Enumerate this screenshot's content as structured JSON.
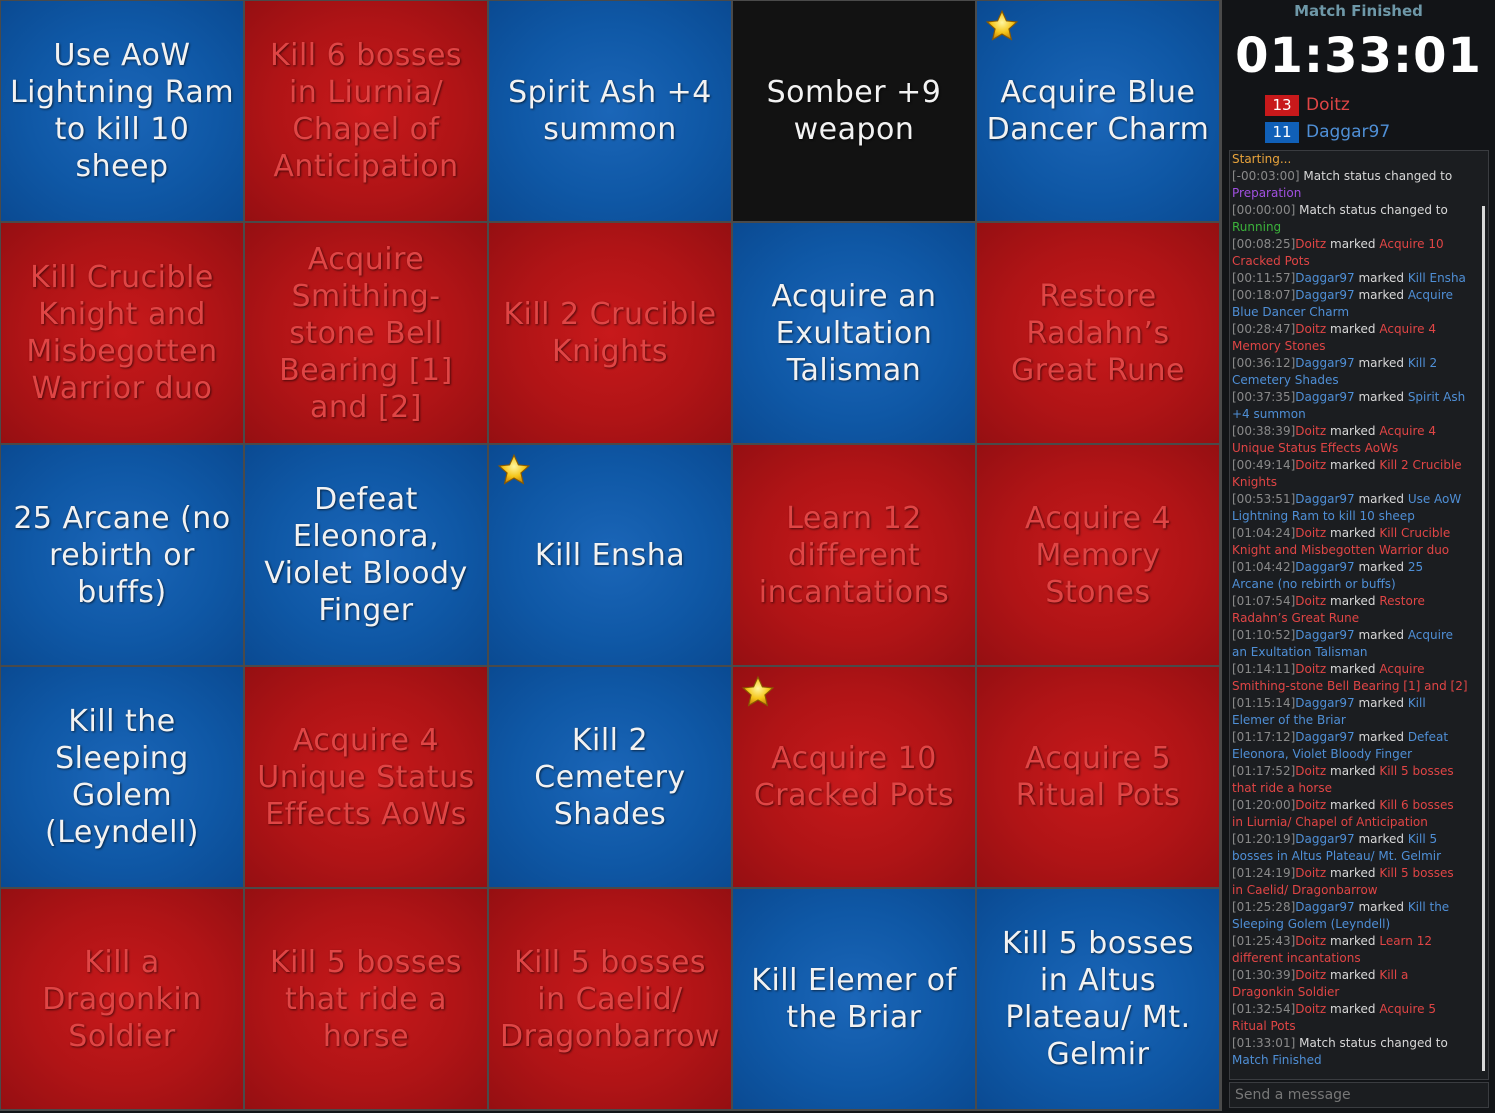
{
  "board": {
    "cells": [
      {
        "text": "Use AoW Lightning Ram to kill 10 sheep",
        "color": "blue",
        "star": false
      },
      {
        "text": "Kill 6 bosses in Liurnia/ Chapel of Anticipation",
        "color": "red",
        "star": false
      },
      {
        "text": "Spirit Ash +4 summon",
        "color": "blue",
        "star": false
      },
      {
        "text": "Somber +9 weapon",
        "color": "black",
        "star": false
      },
      {
        "text": "Acquire Blue Dancer Charm",
        "color": "blue",
        "star": true
      },
      {
        "text": "Kill Crucible Knight and Misbegotten Warrior duo",
        "color": "red",
        "star": false
      },
      {
        "text": "Acquire Smithing-stone Bell Bearing [1] and [2]",
        "color": "red",
        "star": false
      },
      {
        "text": "Kill 2 Crucible Knights",
        "color": "red",
        "star": false
      },
      {
        "text": "Acquire an Exultation Talisman",
        "color": "blue",
        "star": false
      },
      {
        "text": "Restore Radahn’s Great Rune",
        "color": "red",
        "star": false
      },
      {
        "text": "25 Arcane (no rebirth or buffs)",
        "color": "blue",
        "star": false
      },
      {
        "text": "Defeat Eleonora, Violet Bloody Finger",
        "color": "blue",
        "star": false
      },
      {
        "text": "Kill Ensha",
        "color": "blue",
        "star": true
      },
      {
        "text": "Learn 12 different incantations",
        "color": "red",
        "star": false
      },
      {
        "text": "Acquire 4 Memory Stones",
        "color": "red",
        "star": false
      },
      {
        "text": "Kill the Sleeping Golem (Leyndell)",
        "color": "blue",
        "star": false
      },
      {
        "text": "Acquire 4 Unique Status Effects AoWs",
        "color": "red",
        "star": false
      },
      {
        "text": "Kill 2 Cemetery Shades",
        "color": "blue",
        "star": false
      },
      {
        "text": "Acquire 10 Cracked Pots",
        "color": "red",
        "star": true
      },
      {
        "text": "Acquire 5 Ritual Pots",
        "color": "red",
        "star": false
      },
      {
        "text": "Kill a Dragonkin Soldier",
        "color": "red",
        "star": false
      },
      {
        "text": "Kill 5 bosses that ride a horse",
        "color": "red",
        "star": false
      },
      {
        "text": "Kill 5 bosses in Caelid/ Dragonbarrow",
        "color": "red",
        "star": false
      },
      {
        "text": "Kill Elemer of the Briar",
        "color": "blue",
        "star": false
      },
      {
        "text": "Kill 5 bosses in Altus Plateau/ Mt. Gelmir",
        "color": "blue",
        "star": false
      }
    ]
  },
  "sidebar": {
    "status": "Match Finished",
    "timer": "01:33:01",
    "players": [
      {
        "score": "13",
        "name": "Doitz",
        "color": "#c8191b"
      },
      {
        "score": "11",
        "name": "Daggar97",
        "color": "#1060b8"
      }
    ],
    "chat": {
      "placeholder": "Send a message",
      "starting": "Starting...",
      "messages": [
        {
          "ts": "[-00:03:00]",
          "kind": "status",
          "text": "Match status changed to",
          "value": "Preparation",
          "value_color": "purple"
        },
        {
          "ts": "[00:00:00]",
          "kind": "status",
          "text": "Match status changed to",
          "value": "Running",
          "value_color": "green"
        },
        {
          "ts": "[00:08:25]",
          "kind": "mark",
          "player": "Doitz",
          "team": "red",
          "text": "marked",
          "goal": "Acquire 10 Cracked Pots"
        },
        {
          "ts": "[00:11:57]",
          "kind": "mark",
          "player": "Daggar97",
          "team": "blue",
          "text": "marked",
          "goal": "Kill Ensha"
        },
        {
          "ts": "[00:18:07]",
          "kind": "mark",
          "player": "Daggar97",
          "team": "blue",
          "text": "marked",
          "goal": "Acquire Blue Dancer Charm"
        },
        {
          "ts": "[00:28:47]",
          "kind": "mark",
          "player": "Doitz",
          "team": "red",
          "text": "marked",
          "goal": "Acquire 4 Memory Stones"
        },
        {
          "ts": "[00:36:12]",
          "kind": "mark",
          "player": "Daggar97",
          "team": "blue",
          "text": "marked",
          "goal": "Kill 2 Cemetery Shades"
        },
        {
          "ts": "[00:37:35]",
          "kind": "mark",
          "player": "Daggar97",
          "team": "blue",
          "text": "marked",
          "goal": "Spirit Ash +4 summon"
        },
        {
          "ts": "[00:38:39]",
          "kind": "mark",
          "player": "Doitz",
          "team": "red",
          "text": "marked",
          "goal": "Acquire 4 Unique Status Effects AoWs"
        },
        {
          "ts": "[00:49:14]",
          "kind": "mark",
          "player": "Doitz",
          "team": "red",
          "text": "marked",
          "goal": "Kill 2 Crucible Knights"
        },
        {
          "ts": "[00:53:51]",
          "kind": "mark",
          "player": "Daggar97",
          "team": "blue",
          "text": "marked",
          "goal": "Use AoW Lightning Ram to kill 10 sheep"
        },
        {
          "ts": "[01:04:24]",
          "kind": "mark",
          "player": "Doitz",
          "team": "red",
          "text": "marked",
          "goal": "Kill Crucible Knight and Misbegotten Warrior duo"
        },
        {
          "ts": "[01:04:42]",
          "kind": "mark",
          "player": "Daggar97",
          "team": "blue",
          "text": "marked",
          "goal": "25 Arcane (no rebirth or buffs)"
        },
        {
          "ts": "[01:07:54]",
          "kind": "mark",
          "player": "Doitz",
          "team": "red",
          "text": "marked",
          "goal": "Restore Radahn’s Great Rune"
        },
        {
          "ts": "[01:10:52]",
          "kind": "mark",
          "player": "Daggar97",
          "team": "blue",
          "text": "marked",
          "goal": "Acquire an Exultation Talisman"
        },
        {
          "ts": "[01:14:11]",
          "kind": "mark",
          "player": "Doitz",
          "team": "red",
          "text": "marked",
          "goal": "Acquire Smithing-stone Bell Bearing [1] and [2]"
        },
        {
          "ts": "[01:15:14]",
          "kind": "mark",
          "player": "Daggar97",
          "team": "blue",
          "text": "marked",
          "goal": "Kill Elemer of the Briar"
        },
        {
          "ts": "[01:17:12]",
          "kind": "mark",
          "player": "Daggar97",
          "team": "blue",
          "text": "marked",
          "goal": "Defeat Eleonora, Violet Bloody Finger"
        },
        {
          "ts": "[01:17:52]",
          "kind": "mark",
          "player": "Doitz",
          "team": "red",
          "text": "marked",
          "goal": "Kill 5 bosses that ride a horse"
        },
        {
          "ts": "[01:20:00]",
          "kind": "mark",
          "player": "Doitz",
          "team": "red",
          "text": "marked",
          "goal": "Kill 6 bosses in Liurnia/ Chapel of Anticipation"
        },
        {
          "ts": "[01:20:19]",
          "kind": "mark",
          "player": "Daggar97",
          "team": "blue",
          "text": "marked",
          "goal": "Kill 5 bosses in Altus Plateau/ Mt. Gelmir"
        },
        {
          "ts": "[01:24:19]",
          "kind": "mark",
          "player": "Doitz",
          "team": "red",
          "text": "marked",
          "goal": "Kill 5 bosses in Caelid/ Dragonbarrow"
        },
        {
          "ts": "[01:25:28]",
          "kind": "mark",
          "player": "Daggar97",
          "team": "blue",
          "text": "marked",
          "goal": "Kill the Sleeping Golem (Leyndell)"
        },
        {
          "ts": "[01:25:43]",
          "kind": "mark",
          "player": "Doitz",
          "team": "red",
          "text": "marked",
          "goal": "Learn 12 different incantations"
        },
        {
          "ts": "[01:30:39]",
          "kind": "mark",
          "player": "Doitz",
          "team": "red",
          "text": "marked",
          "goal": "Kill a Dragonkin Soldier"
        },
        {
          "ts": "[01:32:54]",
          "kind": "mark",
          "player": "Doitz",
          "team": "red",
          "text": "marked",
          "goal": "Acquire 5 Ritual Pots"
        },
        {
          "ts": "[01:33:01]",
          "kind": "status",
          "text": "Match status changed to",
          "value": "Match Finished",
          "value_color": "blue"
        }
      ]
    }
  }
}
